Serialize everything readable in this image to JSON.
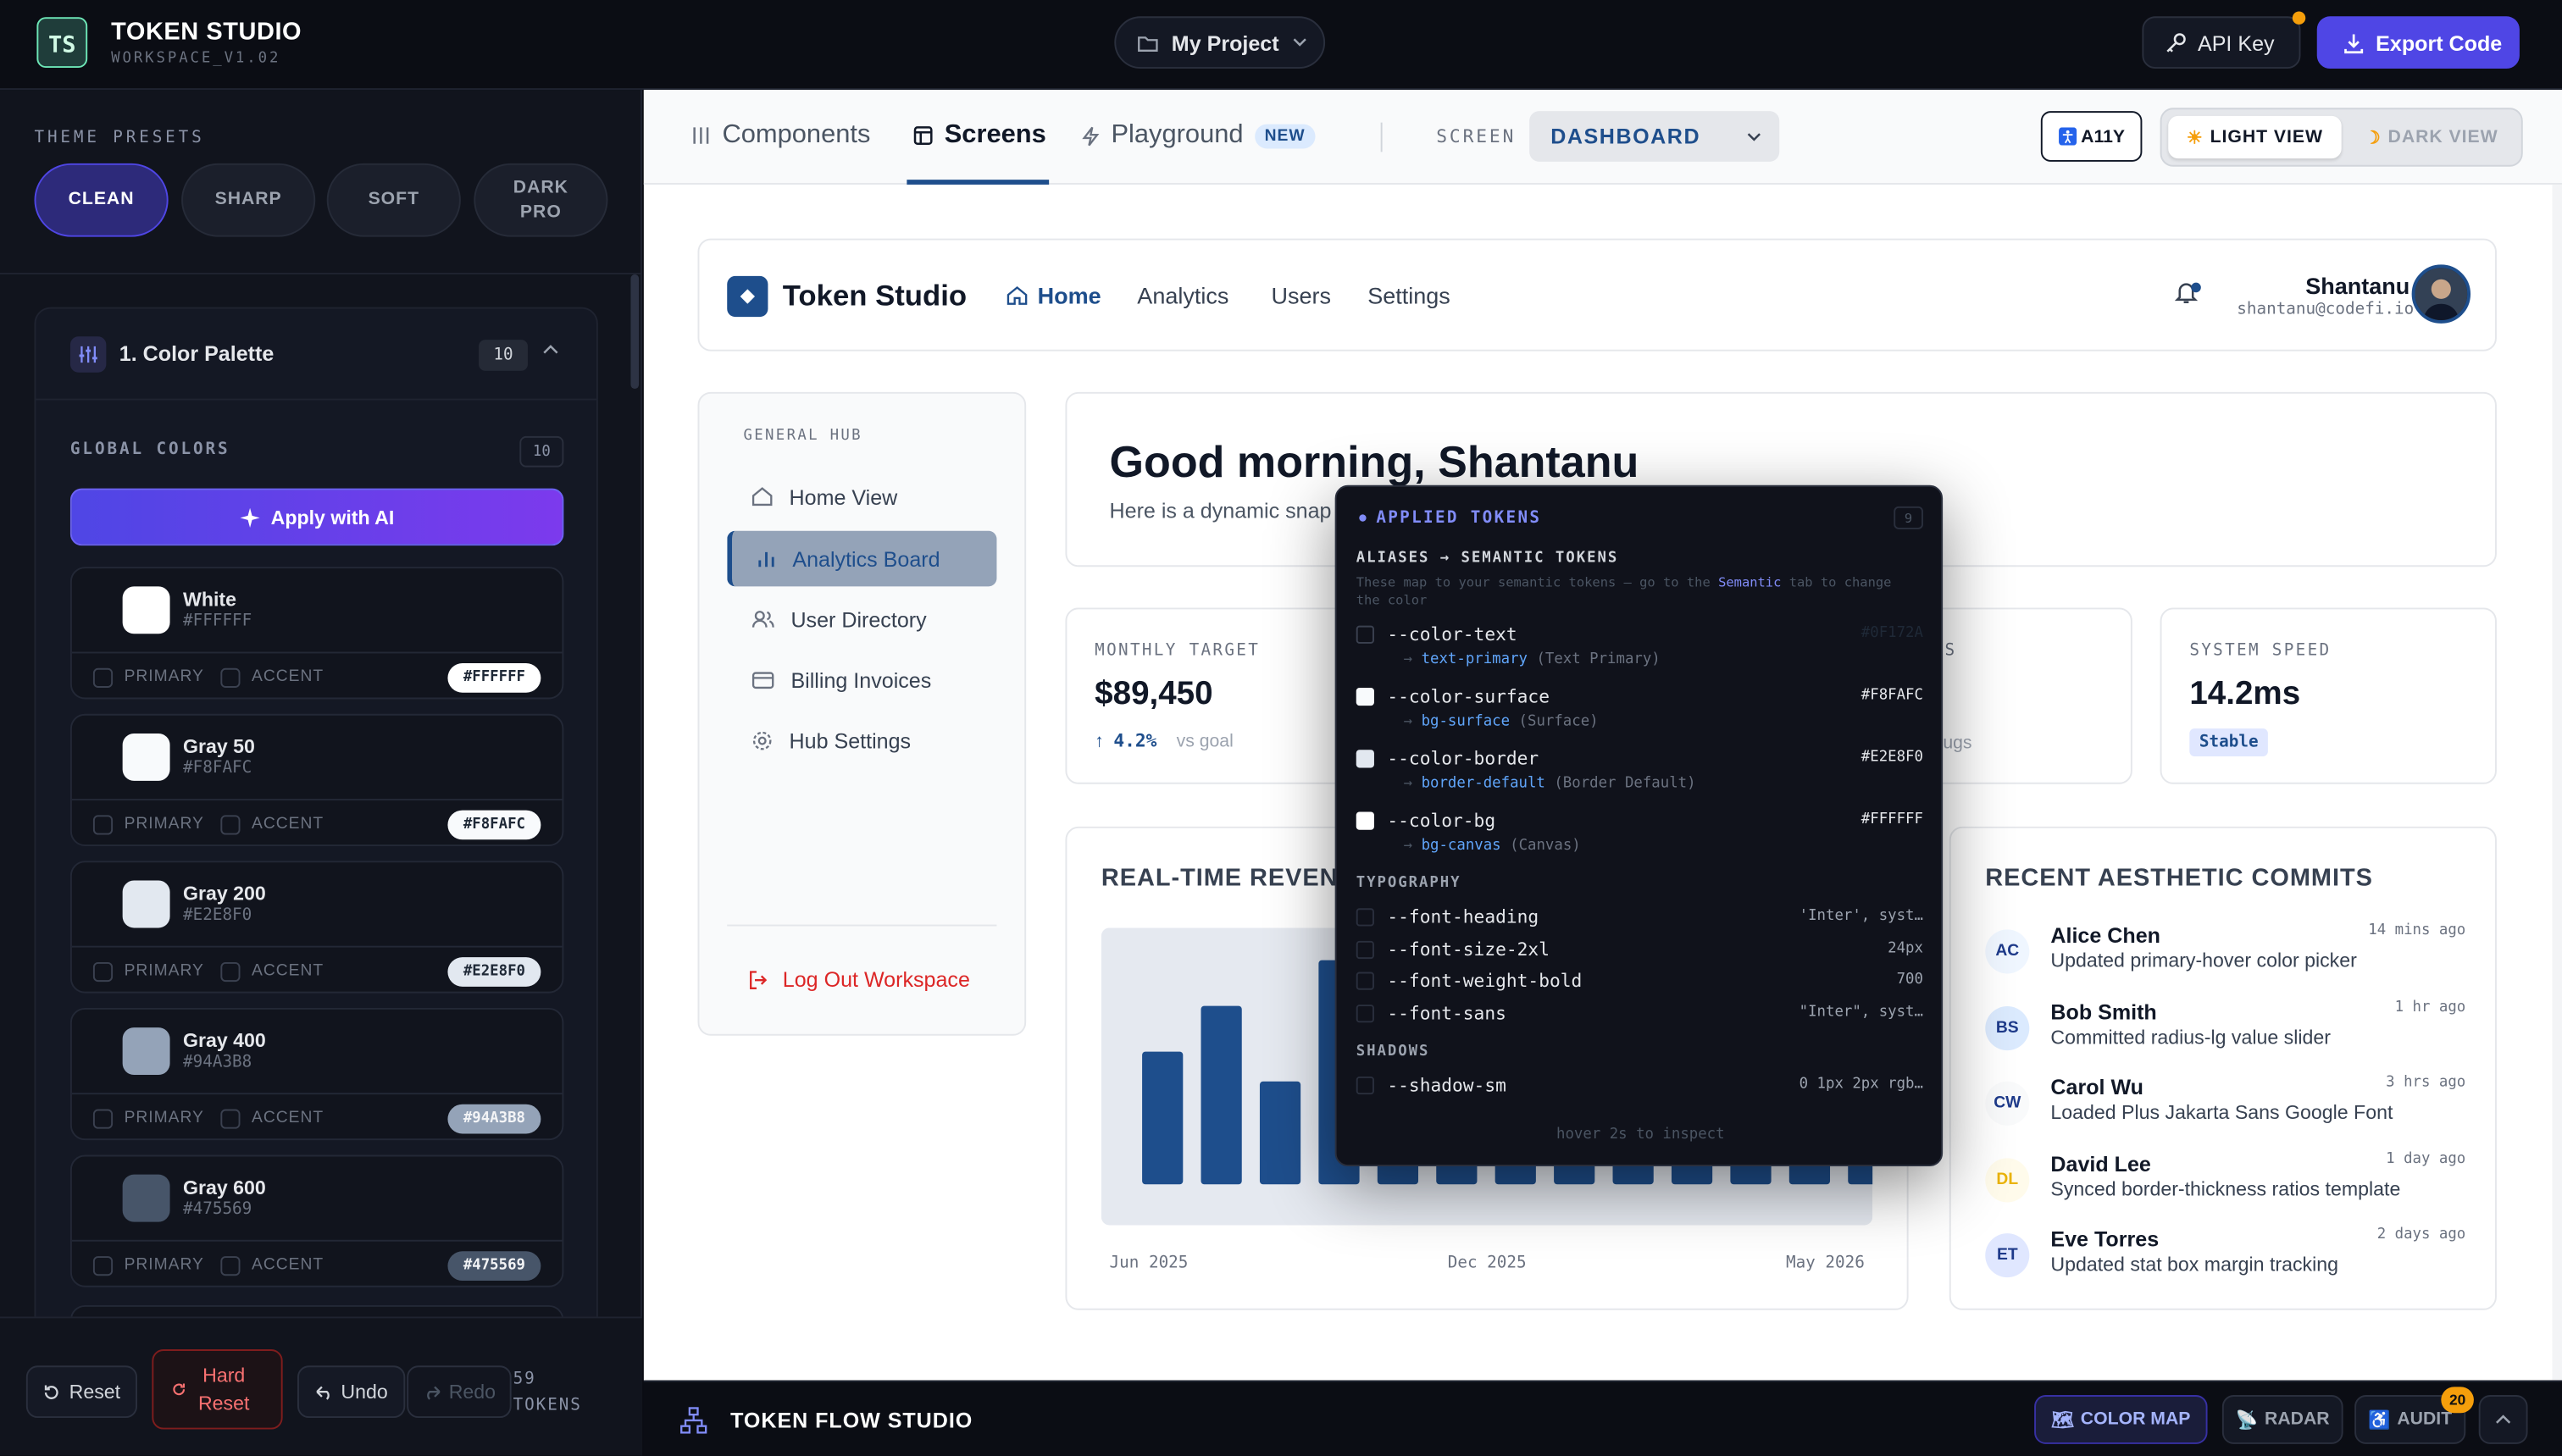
{
  "app": {
    "title": "TOKEN STUDIO",
    "subtitle": "WORKSPACE_V1.02"
  },
  "topbar": {
    "project": "My Project",
    "api_key": "API Key",
    "export": "Export Code"
  },
  "sidebar": {
    "presets_label": "THEME PRESETS",
    "presets": [
      "CLEAN",
      "SHARP",
      "SOFT",
      "DARK PRO"
    ],
    "active_preset": "CLEAN",
    "panel": {
      "title": "1. Color Palette",
      "count": "10"
    },
    "global_label": "GLOBAL COLORS",
    "global_count": "10",
    "ai_button": "Apply with AI",
    "checkbox_primary": "PRIMARY",
    "checkbox_accent": "ACCENT",
    "swatches": [
      {
        "name": "White",
        "hex": "#FFFFFF"
      },
      {
        "name": "Gray 50",
        "hex": "#F8FAFC"
      },
      {
        "name": "Gray 200",
        "hex": "#E2E8F0"
      },
      {
        "name": "Gray 400",
        "hex": "#94A3B8"
      },
      {
        "name": "Gray 600",
        "hex": "#475569"
      }
    ],
    "footer": {
      "reset": "Reset",
      "hard_reset": "Hard Reset",
      "undo": "Undo",
      "redo": "Redo",
      "tokens_count": "59",
      "tokens_label": "TOKENS"
    }
  },
  "tabs": {
    "components": "Components",
    "screens": "Screens",
    "playground": "Playground",
    "new_badge": "NEW",
    "active": "Screens"
  },
  "screen": {
    "label": "SCREEN",
    "value": "DASHBOARD"
  },
  "view": {
    "a11y": "A11Y",
    "light": "LIGHT VIEW",
    "dark": "DARK VIEW",
    "active": "LIGHT VIEW"
  },
  "preview": {
    "brand": "Token Studio",
    "nav": [
      "Home",
      "Analytics",
      "Users",
      "Settings"
    ],
    "nav_active": "Home",
    "user": {
      "name": "Shantanu",
      "email": "shantanu@codefi.io"
    },
    "hub_label": "GENERAL HUB",
    "hub_items": [
      "Home View",
      "Analytics Board",
      "User Directory",
      "Billing Invoices",
      "Hub Settings"
    ],
    "hub_active": "Analytics Board",
    "logout": "Log Out Workspace",
    "greeting": "Good morning, Shantanu",
    "greeting_sub": "Here is a dynamic snap",
    "stats": [
      {
        "label": "MONTHLY TARGET",
        "value": "$89,450",
        "delta": "4.2%",
        "delta_note": "vs goal"
      },
      {
        "label": "TS",
        "value": "",
        "note": "bugs"
      },
      {
        "label": "SYSTEM SPEED",
        "value": "14.2ms",
        "badge": "Stable"
      }
    ],
    "chart_title": "REAL-TIME REVEN",
    "chart_x_labels": [
      "Jun 2025",
      "Dec 2025",
      "May 2026"
    ],
    "commits_title": "RECENT AESTHETIC COMMITS",
    "commits": [
      {
        "initials": "AC",
        "name": "Alice Chen",
        "desc": "Updated primary-hover color picker",
        "time": "14 mins ago"
      },
      {
        "initials": "BS",
        "name": "Bob Smith",
        "desc": "Committed radius-lg value slider",
        "time": "1 hr ago"
      },
      {
        "initials": "CW",
        "name": "Carol Wu",
        "desc": "Loaded Plus Jakarta Sans Google Font",
        "time": "3 hrs ago"
      },
      {
        "initials": "DL",
        "name": "David Lee",
        "desc": "Synced border-thickness ratios template",
        "time": "1 day ago"
      },
      {
        "initials": "ET",
        "name": "Eve Torres",
        "desc": "Updated stat box margin tracking",
        "time": "2 days ago"
      }
    ]
  },
  "popover": {
    "title": "APPLIED TOKENS",
    "count": "9",
    "aliases_title": "ALIASES → SEMANTIC TOKENS",
    "desc_pre": "These map to your semantic tokens — go to the",
    "desc_link": "Semantic",
    "desc_post": "tab to change the color",
    "color_tokens": [
      {
        "name": "--color-text",
        "alias": "text-primary",
        "alias_desc": "(Text Primary)",
        "value": "#0F172A",
        "swatch": "#0F172A"
      },
      {
        "name": "--color-surface",
        "alias": "bg-surface",
        "alias_desc": "(Surface)",
        "value": "#F8FAFC",
        "swatch": "#F8FAFC"
      },
      {
        "name": "--color-border",
        "alias": "border-default",
        "alias_desc": "(Border Default)",
        "value": "#E2E8F0",
        "swatch": "#E2E8F0"
      },
      {
        "name": "--color-bg",
        "alias": "bg-canvas",
        "alias_desc": "(Canvas)",
        "value": "#FFFFFF",
        "swatch": "#FFFFFF"
      }
    ],
    "typography_title": "TYPOGRAPHY",
    "typography": [
      {
        "name": "--font-heading",
        "value": "'Inter', syst…"
      },
      {
        "name": "--font-size-2xl",
        "value": "24px"
      },
      {
        "name": "--font-weight-bold",
        "value": "700"
      },
      {
        "name": "--font-sans",
        "value": "\"Inter\", syst…"
      }
    ],
    "shadows_title": "SHADOWS",
    "shadows": [
      {
        "name": "--shadow-sm",
        "value": "0 1px 2px rgb…"
      }
    ],
    "footer": "hover 2s to inspect"
  },
  "bottombar": {
    "title": "TOKEN FLOW STUDIO",
    "color_map": "COLOR MAP",
    "radar": "RADAR",
    "audit": "AUDIT",
    "audit_badge": "20"
  },
  "colors": {
    "accent": "#4F46E5",
    "brand": "#1E4E8C",
    "danger": "#DC2626",
    "warning": "#F59E0B"
  },
  "chart_data": {
    "type": "bar",
    "title": "REAL-TIME REVEN",
    "x_tick_labels": [
      "Jun 2025",
      "Dec 2025",
      "May 2026"
    ],
    "values": [
      58,
      78,
      45,
      98,
      30,
      30,
      30,
      30,
      30,
      30,
      30,
      30,
      30
    ],
    "note": "Relative bar heights; no y-axis labels visible. Bars 5-13 partly hidden behind tooltip."
  }
}
